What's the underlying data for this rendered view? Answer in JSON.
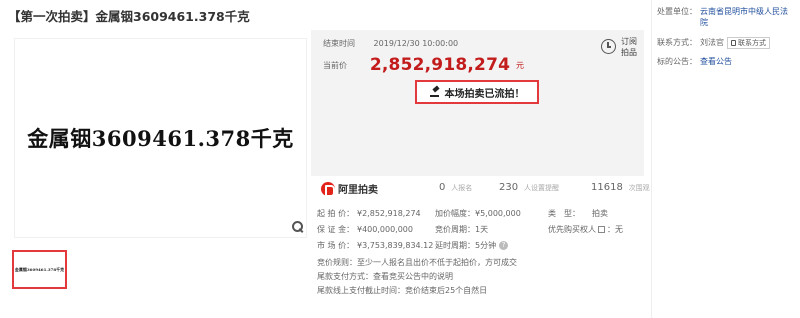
{
  "title": "【第一次拍卖】金属铟3609461.378千克",
  "image": {
    "main_text": "金属铟3609461.378千克",
    "thumb_text": "金属铟3609461.378千克"
  },
  "info": {
    "end_time_label": "结束时间",
    "end_time": "2019/12/30 10:00:00",
    "current_price_label": "当前价",
    "current_price": "2,852,918,274",
    "currency_unit": "元",
    "subscribe_label": "订阅拍品",
    "status_text": "本场拍卖已流拍！"
  },
  "stats": {
    "logo_text": "阿里拍卖",
    "signups_num": "0",
    "signups_label": "人报名",
    "reminders_num": "230",
    "reminders_label": "人设置提醒",
    "views_num": "11618",
    "views_label": "次围观"
  },
  "details": {
    "col1": [
      {
        "k": "起 拍 价：",
        "v": "¥2,852,918,274"
      },
      {
        "k": "保 证 金：",
        "v": "¥400,000,000"
      },
      {
        "k": "市 场 价：",
        "v": "¥3,753,839,834.12"
      }
    ],
    "col2": [
      {
        "k": "加价幅度：",
        "v": "¥5,000,000"
      },
      {
        "k": "竞价周期：",
        "v": "1天"
      },
      {
        "k": "延时周期：",
        "v": "5分钟"
      }
    ],
    "col3": [
      {
        "k": "类　型：",
        "v": "拍卖"
      },
      {
        "k": "优先购买权人",
        "v": "：无"
      }
    ],
    "rules": [
      {
        "k": "竞价规则：",
        "v": "至少一人报名且出价不低于起拍价，方可成交"
      },
      {
        "k": "尾款支付方式：",
        "v": "查看竞买公告中的说明"
      },
      {
        "k": "尾款线上支付截止时间：",
        "v": "竞价结束后25个自然日"
      }
    ]
  },
  "side": {
    "org_label": "处置单位：",
    "org_value": "云南省昆明市中级人民法院",
    "contact_label": "联系方式：",
    "contact_name": "刘法官",
    "contact_button": "联系方式",
    "notice_label": "标的公告：",
    "notice_link": "查看公告"
  }
}
